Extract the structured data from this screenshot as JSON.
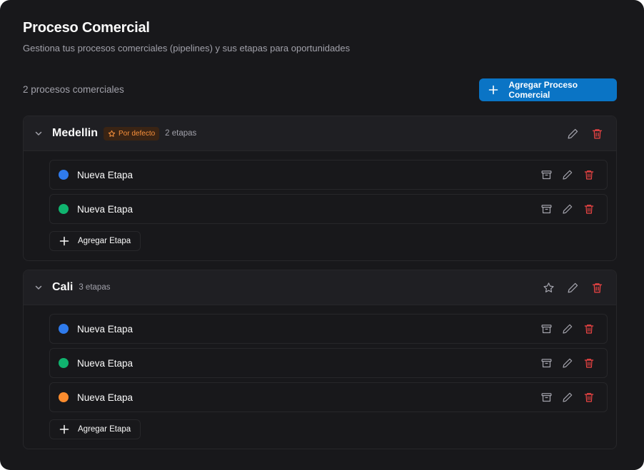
{
  "header": {
    "title": "Proceso Comercial",
    "subtitle": "Gestiona tus procesos comerciales (pipelines) y sus etapas para oportunidades"
  },
  "toolbar": {
    "count_text": "2 procesos comerciales",
    "add_label": "Agregar Proceso Comercial"
  },
  "colors": {
    "panel_bg": "#18181b",
    "primary_button": "#0a74c5",
    "danger": "#ef4444",
    "default_badge_text": "#fb923c",
    "stage_blue": "#2f7bec",
    "stage_green": "#10b46f",
    "stage_orange": "#fb8c2e"
  },
  "pipelines": [
    {
      "name": "Medellin",
      "default_badge": "Por defecto",
      "stages_count": "2 etapas",
      "stages": [
        {
          "name": "Nueva Etapa",
          "color": "#2f7bec"
        },
        {
          "name": "Nueva Etapa",
          "color": "#10b46f"
        }
      ],
      "add_stage_label": "Agregar Etapa"
    },
    {
      "name": "Cali",
      "stages_count": "3 etapas",
      "stages": [
        {
          "name": "Nueva Etapa",
          "color": "#2f7bec"
        },
        {
          "name": "Nueva Etapa",
          "color": "#10b46f"
        },
        {
          "name": "Nueva Etapa",
          "color": "#fb8c2e"
        }
      ],
      "add_stage_label": "Agregar Etapa"
    }
  ],
  "icons": {
    "collapse": "chevron-down-icon",
    "default_marker": "star-icon",
    "edit": "pencil-icon",
    "delete": "trash-icon",
    "archive": "archive-icon",
    "add": "plus-icon"
  }
}
